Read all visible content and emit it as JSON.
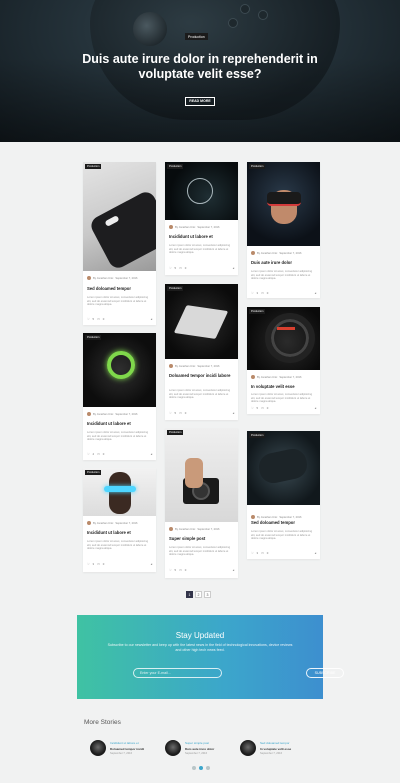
{
  "hero": {
    "badge": "Production",
    "title": "Duis aute irure dolor in reprehenderit in voluptate velit esse?",
    "button": "READ MORE"
  },
  "cards": [
    {
      "tag": "Production",
      "author": "By Jonathan Unic",
      "date": "September 7, 2016",
      "title": "Sed doloamed tempor",
      "excerpt": "Lorem ipsum dolor sit amet, consectetur adipisicing elit, sed do eiusmod tempor incididunt ut labore et dolore magna aliqua.",
      "likes": "5",
      "comments": "0"
    },
    {
      "tag": "Production",
      "author": "By Jonathan Unic",
      "date": "September 7, 2016",
      "title": "Incididunt ut labore et",
      "excerpt": "Lorem ipsum dolor sit amet, consectetur adipisicing elit, sed do eiusmod tempor incididunt ut labore et dolore magna aliqua.",
      "likes": "4",
      "comments": "0"
    },
    {
      "tag": "Production",
      "author": "By Jonathan Unic",
      "date": "September 7, 2016",
      "title": "Duis aute irure dolor",
      "excerpt": "Lorem ipsum dolor sit amet, consectetur adipisicing elit, sed do eiusmod tempor incididunt ut labore et dolore magna aliqua.",
      "likes": "3",
      "comments": "0"
    },
    {
      "tag": "Production",
      "author": "By Jonathan Unic",
      "date": "September 7, 2016",
      "title": "Incididunt ut labore et",
      "excerpt": "Lorem ipsum dolor sit amet, consectetur adipisicing elit, sed do eiusmod tempor incididunt ut labore et dolore magna aliqua.",
      "likes": "3",
      "comments": "0"
    },
    {
      "tag": "Production",
      "author": "By Jonathan Unic",
      "date": "September 7, 2016",
      "title": "Doloamed tempor incidi labore",
      "excerpt": "Lorem ipsum dolor sit amet, consectetur adipisicing elit, sed do eiusmod tempor incididunt ut labore et dolore magna aliqua.",
      "likes": "5",
      "comments": "0"
    },
    {
      "tag": "Production",
      "author": "By Jonathan Unic",
      "date": "September 7, 2016",
      "title": "In voluptate velit esse",
      "excerpt": "Lorem ipsum dolor sit amet, consectetur adipisicing elit, sed do eiusmod tempor incididunt ut labore et dolore magna aliqua.",
      "likes": "5",
      "comments": "0"
    },
    {
      "tag": "Production",
      "author": "By Jonathan Unic",
      "date": "September 7, 2016",
      "title": "Incididunt ut labore et",
      "excerpt": "Lorem ipsum dolor sit amet, consectetur adipisicing elit, sed do eiusmod tempor incididunt ut labore et dolore magna aliqua.",
      "likes": "3",
      "comments": "0"
    },
    {
      "tag": "Production",
      "author": "By Jonathan Unic",
      "date": "September 7, 2016",
      "title": "Super simple post",
      "excerpt": "Lorem ipsum dolor sit amet, consectetur adipisicing elit, sed do eiusmod tempor incididunt ut labore et dolore magna aliqua.",
      "likes": "5",
      "comments": "0"
    },
    {
      "tag": "Production",
      "author": "By Jonathan Unic",
      "date": "September 7, 2016",
      "title": "Sed doloamed tempor",
      "excerpt": "Lorem ipsum dolor sit amet, consectetur adipisicing elit, sed do eiusmod tempor incididunt ut labore et dolore magna aliqua.",
      "likes": "3",
      "comments": "0"
    }
  ],
  "pagination": [
    "1",
    "2",
    "3"
  ],
  "subscribe": {
    "title": "Stay Updated",
    "text": "Subscribe to our newsletter and keep up with the latest news in the field of technological innovations, device reviews and other high tech news feed.",
    "placeholder": "Enter your E-mail...",
    "button": "SUBSCRIBE"
  },
  "more": {
    "title": "More Stories",
    "stories": [
      {
        "category": "Incididunt ut labore et",
        "title": "Doloamed tempor incidi",
        "date": "September 7, 2016"
      },
      {
        "category": "Super simple post",
        "title": "Duis aute irure dolor",
        "date": "September 7, 2016"
      },
      {
        "category": "Sed doloamed tempor",
        "title": "In voluptate velit esse",
        "date": "September 7, 2016"
      }
    ]
  },
  "colors": {
    "accent": "#3ca6cb",
    "dark": "#33344a"
  }
}
